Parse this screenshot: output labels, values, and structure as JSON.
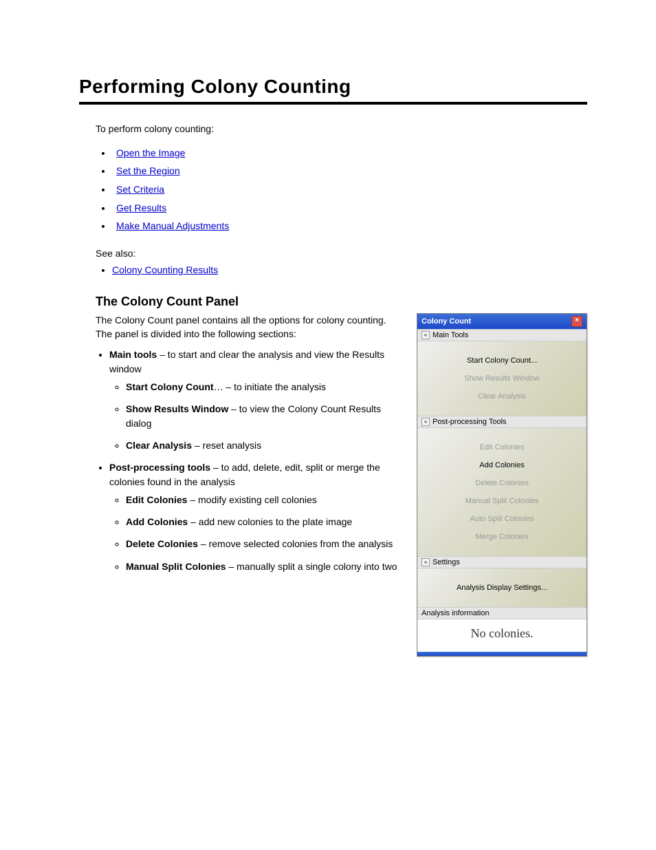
{
  "heading": "Performing Colony Counting",
  "intro": "To perform colony counting:",
  "links": [
    "Open the Image",
    "Set the Region",
    "Set Criteria",
    "Get Results",
    "Make Manual Adjustments"
  ],
  "seealso_label": "See also:",
  "seealso": [
    "Colony Counting Results"
  ],
  "subheading": "The Colony Count Panel",
  "para_before": "The Colony Count panel contains all the options for colony counting. The panel is divided into the following sections:",
  "bullets": [
    {
      "label": "Main tools",
      "tail": " – to start and clear the analysis and view the Results window",
      "children": [
        {
          "label": "Start Colony Count",
          "tail": "… – to initiate the analysis"
        },
        {
          "label": "Show Results Window",
          "tail": " – to view the Colony Count Results dialog"
        },
        {
          "label": "Clear Analysis",
          "tail": " – reset analysis"
        }
      ]
    },
    {
      "label": "Post-processing tools",
      "tail": " – to add, delete, edit, split or merge the colonies found in the analysis",
      "children": [
        {
          "label": "Edit Colonies",
          "tail": " – modify existing cell colonies"
        },
        {
          "label": "Add Colonies",
          "tail": " – add new colonies to the plate image"
        },
        {
          "label": "Delete Colonies",
          "tail": " – remove selected colonies from the analysis"
        },
        {
          "label": "Manual Split Colonies",
          "tail": " – manually split a single colony into two"
        }
      ]
    }
  ],
  "panel": {
    "title": "Colony Count",
    "close": "×",
    "sections": {
      "main": {
        "head": "Main Tools",
        "items": [
          {
            "label": "Start Colony Count...",
            "enabled": true
          },
          {
            "label": "Show Results Window",
            "enabled": false
          },
          {
            "label": "Clear Analysis",
            "enabled": false
          }
        ]
      },
      "post": {
        "head": "Post-processing Tools",
        "items": [
          {
            "label": "Edit Colonies",
            "enabled": false
          },
          {
            "label": "Add Colonies",
            "enabled": true
          },
          {
            "label": "Delete Colonies",
            "enabled": false
          },
          {
            "label": "Manual Split Colonies",
            "enabled": false
          },
          {
            "label": "Auto Split Colonies",
            "enabled": false
          },
          {
            "label": "Merge Colonies",
            "enabled": false
          }
        ]
      },
      "settings": {
        "head": "Settings",
        "items": [
          {
            "label": "Analysis Display Settings...",
            "enabled": true
          }
        ]
      },
      "info": {
        "head": "Analysis information",
        "text": "No colonies."
      }
    }
  }
}
